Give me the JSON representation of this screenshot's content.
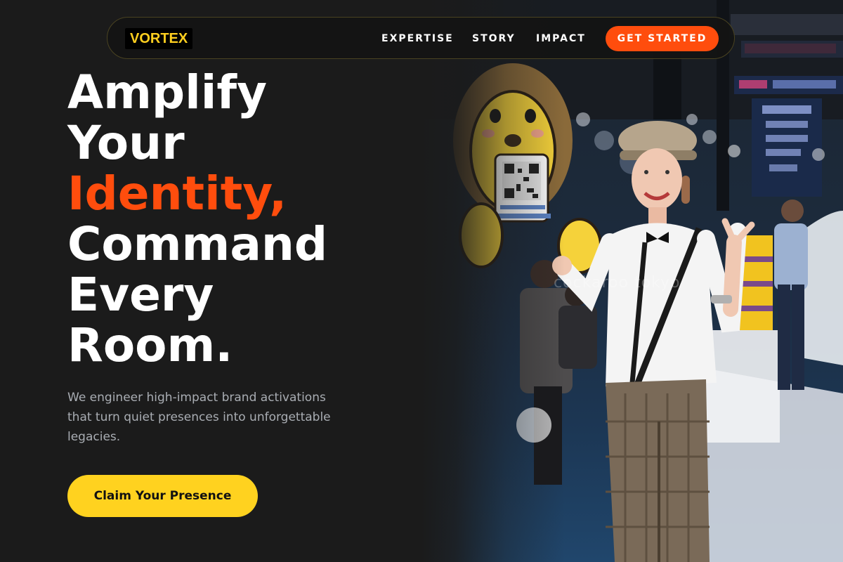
{
  "brand": {
    "logo_text": "VORTEX",
    "logo_color": "#ffcf1f",
    "accent": "#ff4d0d",
    "cta_color": "#ffd21f"
  },
  "nav": {
    "links": [
      {
        "label": "EXPERTISE"
      },
      {
        "label": "STORY"
      },
      {
        "label": "IMPACT"
      }
    ],
    "cta_label": "GET STARTED"
  },
  "hero": {
    "headline_lines": [
      "Amplify",
      "Your",
      "Identity,",
      "Command",
      "Every",
      "Room."
    ],
    "highlight_line_index": 2,
    "subtitle_lines": [
      "We engineer high-impact brand activations",
      "that turn quiet presences into unforgettable",
      "legacies."
    ],
    "cta_label": "Claim Your Presence"
  },
  "photo": {
    "subject": "smiling woman in flat cap and suspenders holding a cartoon lion sign with QR code at an exhibition",
    "watermark": "cockaroo tokyo"
  }
}
